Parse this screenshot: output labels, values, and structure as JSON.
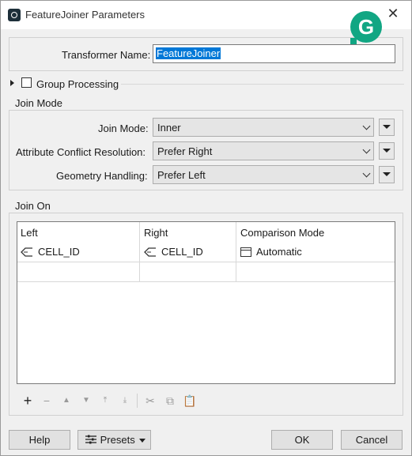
{
  "window": {
    "title": "FeatureJoiner Parameters",
    "close_glyph": "✕",
    "grammarly_letter": "G"
  },
  "transformer": {
    "name_label": "Transformer Name:",
    "name_value": "FeatureJoiner"
  },
  "group_processing": {
    "label": "Group Processing",
    "checked": false
  },
  "join_mode_section": {
    "title": "Join Mode",
    "join_mode_label": "Join Mode:",
    "join_mode_value": "Inner",
    "conflict_label": "Attribute Conflict Resolution:",
    "conflict_value": "Prefer Right",
    "geometry_label": "Geometry Handling:",
    "geometry_value": "Prefer Left"
  },
  "join_on_section": {
    "title": "Join On",
    "columns": [
      "Left",
      "Right",
      "Comparison Mode"
    ],
    "rows": [
      {
        "left": "CELL_ID",
        "right": "CELL_ID",
        "mode": "Automatic"
      }
    ]
  },
  "toolbar": {
    "icons": [
      "plus-icon",
      "minus-icon",
      "move-up-icon",
      "move-down-icon",
      "move-top-icon",
      "move-bottom-icon",
      "cut-icon",
      "copy-icon",
      "paste-icon"
    ]
  },
  "buttons": {
    "help": "Help",
    "presets": "Presets",
    "ok": "OK",
    "cancel": "Cancel"
  },
  "colors": {
    "selection": "#0078d7",
    "grammarly": "#11a683"
  }
}
